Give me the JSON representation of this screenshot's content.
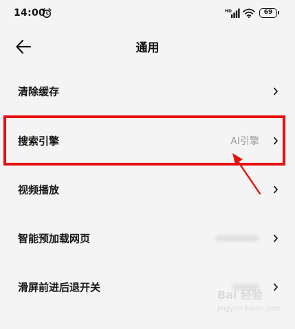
{
  "status_bar": {
    "time": "14:00",
    "network_label": "HD",
    "battery": "69"
  },
  "header": {
    "title": "通用"
  },
  "settings": {
    "items": [
      {
        "label": "清除缓存"
      },
      {
        "label": "搜索引擎",
        "value": "AI引擎"
      },
      {
        "label": "视频播放"
      },
      {
        "label": "智能预加载网页"
      },
      {
        "label": "滑屏前进后退开关"
      }
    ]
  },
  "watermark": {
    "top": "Bai 经验",
    "bottom": "jingyan.baidu.com"
  },
  "colors": {
    "background": "#f4f4f4",
    "highlight": "#e60f0f"
  }
}
